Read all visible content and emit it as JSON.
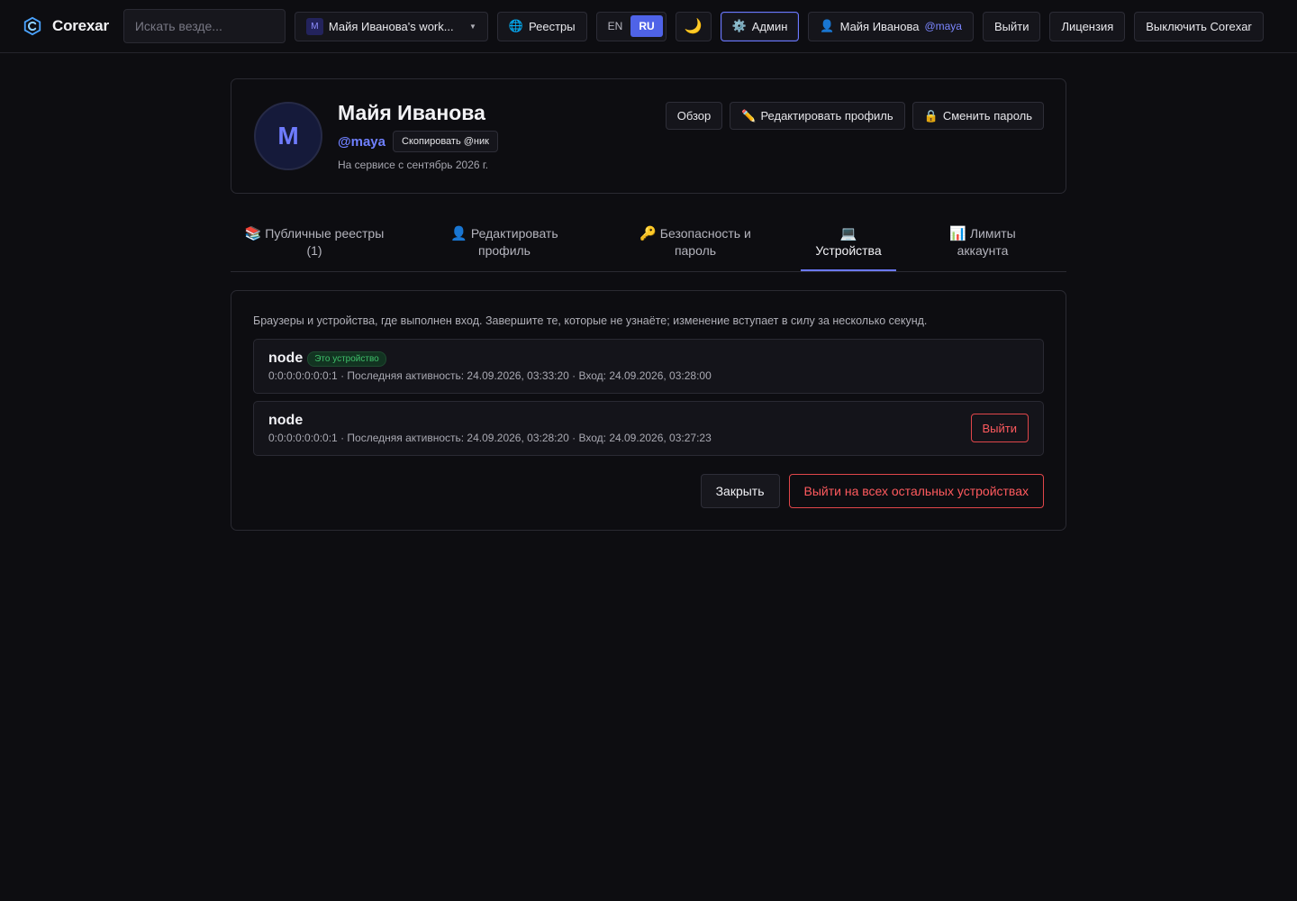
{
  "topbar": {
    "brand_name": "Corexar",
    "search_placeholder": "Искать везде...",
    "workspace_initial": "M",
    "workspace_label": "Майя Иванова's work...",
    "registries_label": "Реестры",
    "lang_en": "EN",
    "lang_ru": "RU",
    "theme_icon": "🌙",
    "admin_label": "Админ",
    "user_name": "Майя Иванова",
    "user_nick": "@maya",
    "logout_label": "Выйти",
    "license_label": "Лицензия",
    "shutdown_label": "Выключить Corexar"
  },
  "profile": {
    "avatar_initial": "M",
    "name": "Майя Иванова",
    "nick": "@maya",
    "copy_nick_label": "Скопировать @ник",
    "since": "На сервисе с сентябрь 2026 г.",
    "actions": {
      "overview": "Обзор",
      "edit": "Редактировать профиль",
      "change_password": "Сменить пароль"
    }
  },
  "tabs": {
    "public_registries_l1": "Публичные реестры",
    "public_registries_l2": "(1)",
    "edit_profile_l1": "Редактировать",
    "edit_profile_l2": "профиль",
    "security_l1": "Безопасность и",
    "security_l2": "пароль",
    "devices": "Устройства",
    "limits_l1": "Лимиты",
    "limits_l2": "аккаунта"
  },
  "devices": {
    "intro": "Браузеры и устройства, где выполнен вход. Завершите те, которые не узнаёте; изменение вступает в силу за несколько секунд.",
    "sessions": [
      {
        "name": "node",
        "badge": "Это устройство",
        "meta": "0:0:0:0:0:0:0:1 · Последняя активность: 24.09.2026, 03:33:20 · Вход: 24.09.2026, 03:28:00"
      },
      {
        "name": "node",
        "meta": "0:0:0:0:0:0:0:1 · Последняя активность: 24.09.2026, 03:28:20 · Вход: 24.09.2026, 03:27:23",
        "logout_label": "Выйти"
      }
    ],
    "close_label": "Закрыть",
    "logout_all_label": "Выйти на всех остальных устройствах"
  },
  "colors": {
    "accent": "#6b79ff",
    "danger": "#ff5a5e",
    "success": "#3fbf6a",
    "background": "#0d0d11"
  }
}
